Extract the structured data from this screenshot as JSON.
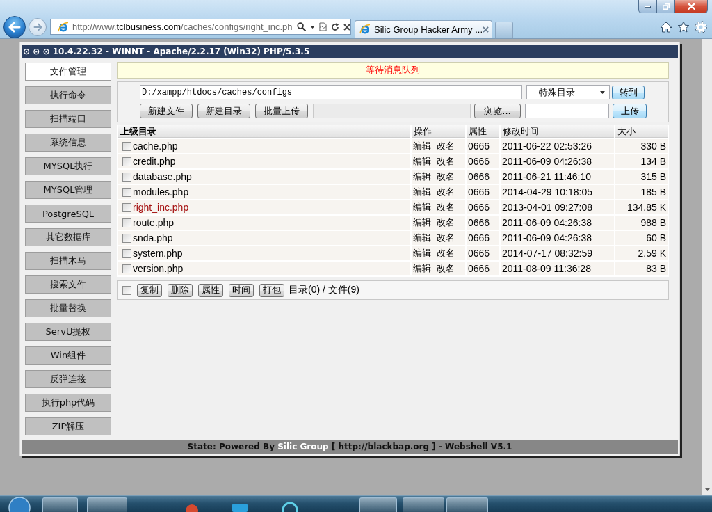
{
  "browser": {
    "address": {
      "prefix": "http://www.",
      "domain": "tclbusiness.com",
      "path": "/caches/configs/right_inc.ph"
    },
    "tabs": [
      {
        "title": "Silic Group Hacker Army ...",
        "selected": true
      }
    ]
  },
  "header": {
    "title": "⊙ ⊙ ⊙ 10.4.22.32 - WINNT - Apache/2.2.17 (Win32) PHP/5.3.5"
  },
  "sidebar": {
    "items": [
      {
        "label": "文件管理",
        "selected": true
      },
      {
        "label": "执行命令",
        "selected": false
      },
      {
        "label": "扫描端口",
        "selected": false
      },
      {
        "label": "系统信息",
        "selected": false
      },
      {
        "label": "MYSQL执行",
        "selected": false
      },
      {
        "label": "MYSQL管理",
        "selected": false
      },
      {
        "label": "PostgreSQL",
        "selected": false
      },
      {
        "label": "其它数据库",
        "selected": false
      },
      {
        "label": "扫描木马",
        "selected": false
      },
      {
        "label": "搜索文件",
        "selected": false
      },
      {
        "label": "批量替换",
        "selected": false
      },
      {
        "label": "ServU提权",
        "selected": false
      },
      {
        "label": "Win组件",
        "selected": false
      },
      {
        "label": "反弹连接",
        "selected": false
      },
      {
        "label": "执行php代码",
        "selected": false
      },
      {
        "label": "ZIP解压",
        "selected": false
      }
    ]
  },
  "notice": {
    "text": "等待消息队列"
  },
  "toolbar": {
    "path": "D:/xampp/htdocs/caches/configs",
    "special_directory": "---特殊目录---",
    "go_button": "转到",
    "buttons": [
      "新建文件",
      "新建目录",
      "批量上传"
    ],
    "browse_button": "浏览...",
    "upload_button": "上传"
  },
  "table": {
    "columns": [
      "上级目录",
      "操作",
      "属性",
      "修改时间",
      "大小"
    ],
    "rows": [
      {
        "name": "cache.php",
        "checked": false,
        "highlighted": false,
        "actions": [
          "编辑",
          "改名"
        ],
        "perms": "0666",
        "modified": "2011-06-22 02:53:26",
        "size": "330 B"
      },
      {
        "name": "credit.php",
        "checked": false,
        "highlighted": false,
        "actions": [
          "编辑",
          "改名"
        ],
        "perms": "0666",
        "modified": "2011-06-09 04:26:38",
        "size": "134 B"
      },
      {
        "name": "database.php",
        "checked": false,
        "highlighted": false,
        "actions": [
          "编辑",
          "改名"
        ],
        "perms": "0666",
        "modified": "2011-06-21 11:46:10",
        "size": "315 B"
      },
      {
        "name": "modules.php",
        "checked": false,
        "highlighted": false,
        "actions": [
          "编辑",
          "改名"
        ],
        "perms": "0666",
        "modified": "2014-04-29 10:18:05",
        "size": "185 B"
      },
      {
        "name": "right_inc.php",
        "checked": false,
        "highlighted": true,
        "actions": [
          "编辑",
          "改名"
        ],
        "perms": "0666",
        "modified": "2013-04-01 09:27:08",
        "size": "134.85 K"
      },
      {
        "name": "route.php",
        "checked": false,
        "highlighted": false,
        "actions": [
          "编辑",
          "改名"
        ],
        "perms": "0666",
        "modified": "2011-06-09 04:26:38",
        "size": "988 B"
      },
      {
        "name": "snda.php",
        "checked": false,
        "highlighted": false,
        "actions": [
          "编辑",
          "改名"
        ],
        "perms": "0666",
        "modified": "2011-06-09 04:26:38",
        "size": "60 B"
      },
      {
        "name": "system.php",
        "checked": false,
        "highlighted": false,
        "actions": [
          "编辑",
          "改名"
        ],
        "perms": "0666",
        "modified": "2014-07-17 08:32:59",
        "size": "2.59 K"
      },
      {
        "name": "version.php",
        "checked": false,
        "highlighted": false,
        "actions": [
          "编辑",
          "改名"
        ],
        "perms": "0666",
        "modified": "2011-08-09 11:36:28",
        "size": "83 B"
      }
    ]
  },
  "bulk": {
    "checked": false,
    "buttons": [
      "复制",
      "删除",
      "属性",
      "时间",
      "打包"
    ],
    "summary": "目录(0) / 文件(9)"
  },
  "footer": {
    "before": "State: Powered By",
    "highlight": "Silic Group",
    "after": "[ http://blackbap.org ] - Webshell V5.1"
  }
}
